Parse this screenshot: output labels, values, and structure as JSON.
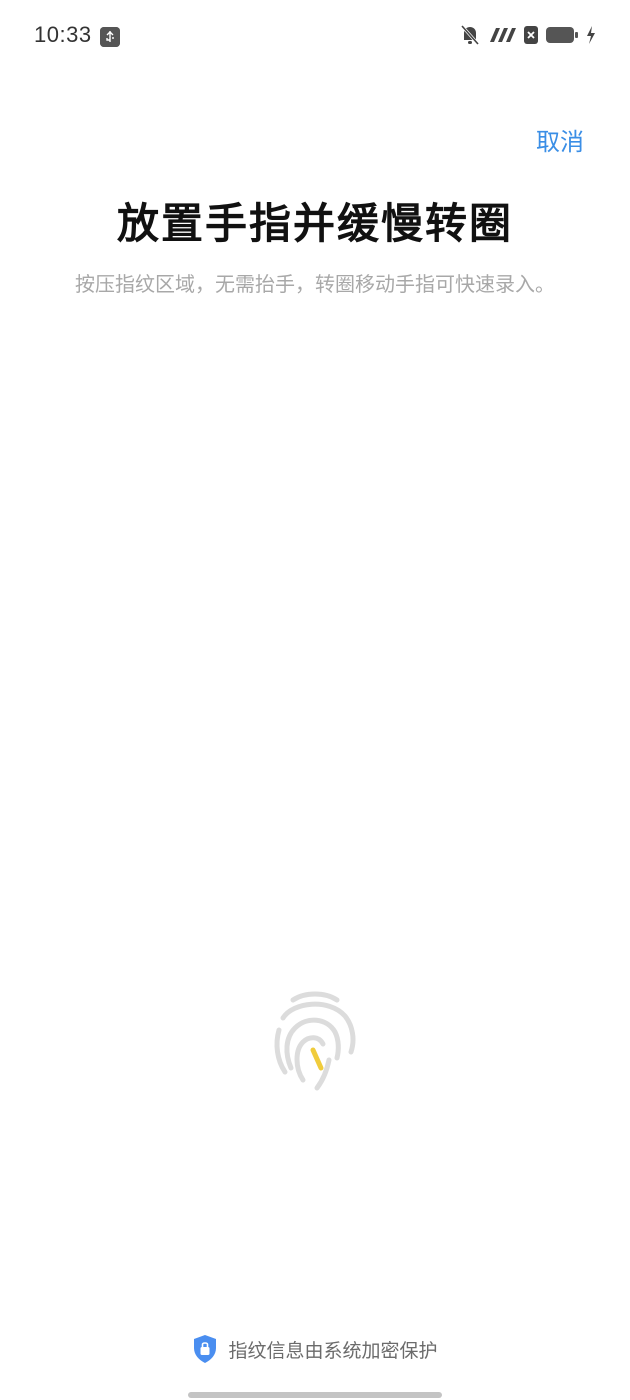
{
  "status_bar": {
    "time": "10:33",
    "icons": [
      "usb-debug-icon",
      "bell-muted-icon",
      "signal-icon",
      "no-sim-icon",
      "battery-icon",
      "charging-icon"
    ]
  },
  "header": {
    "cancel_label": "取消"
  },
  "main": {
    "title": "放置手指并缓慢转圈",
    "subtitle": "按压指纹区域，无需抬手，转圈移动手指可快速录入。"
  },
  "footer": {
    "security_note": "指纹信息由系统加密保护"
  },
  "colors": {
    "accent": "#3a8ee6",
    "fingerprint_ridge": "#dcdcdc",
    "fingerprint_progress": "#f0cc3c",
    "shield": "#4a8ef0"
  }
}
